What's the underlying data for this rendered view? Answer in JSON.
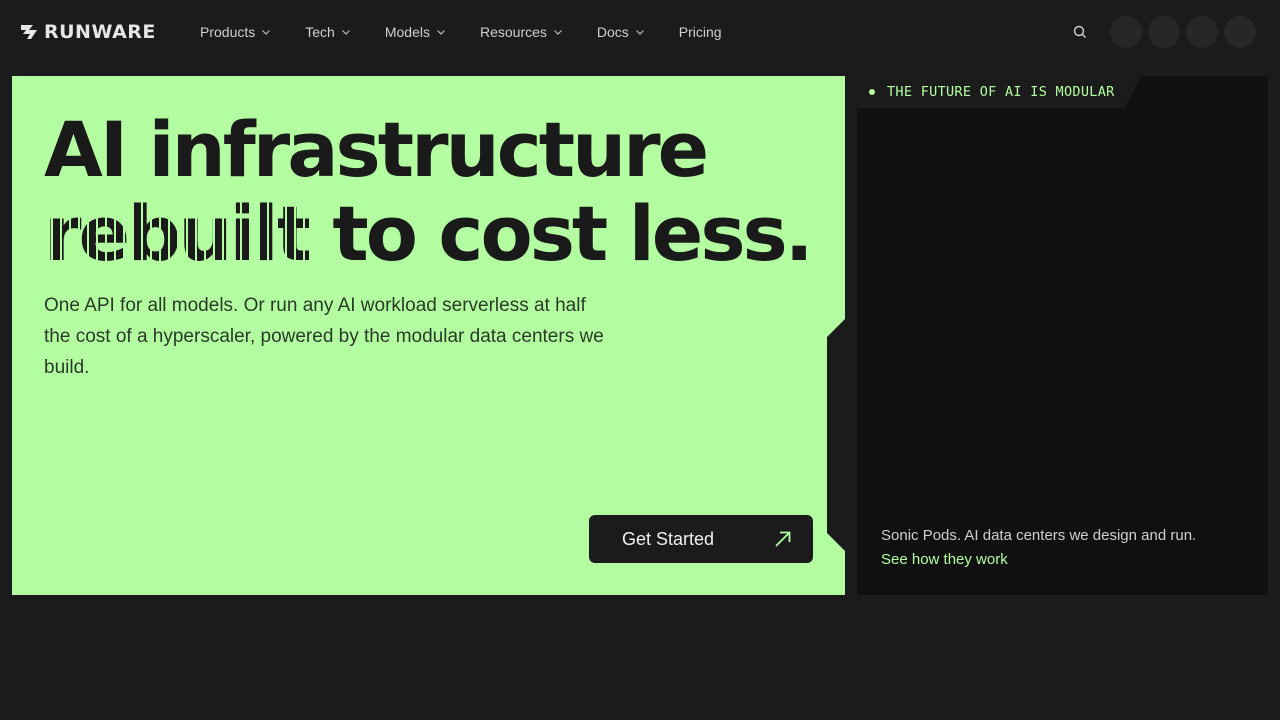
{
  "brand": {
    "name": "RUNWARE"
  },
  "nav": {
    "items": [
      {
        "label": "Products",
        "has_dropdown": true
      },
      {
        "label": "Tech",
        "has_dropdown": true
      },
      {
        "label": "Models",
        "has_dropdown": true
      },
      {
        "label": "Resources",
        "has_dropdown": true
      },
      {
        "label": "Docs",
        "has_dropdown": true
      },
      {
        "label": "Pricing",
        "has_dropdown": false
      }
    ],
    "search_icon": "search-icon"
  },
  "hero": {
    "headline_line1": "AI infrastructure",
    "headline_dashed": "rebuilt",
    "headline_rest": " to cost less.",
    "subcopy": "One API for all models. Or run any AI workload serverless at half the cost of a hyperscaler, powered by the modular data centers we build.",
    "cta_label": "Get Started",
    "cta_icon": "arrow-up-right-icon"
  },
  "panel": {
    "tag": "THE FUTURE OF AI IS MODULAR",
    "caption": "Sonic Pods. AI data centers we design and run.",
    "link": "See how they work"
  },
  "colors": {
    "background": "#1b1b1b",
    "accent": "#b3fea0",
    "panel": "#101010"
  }
}
